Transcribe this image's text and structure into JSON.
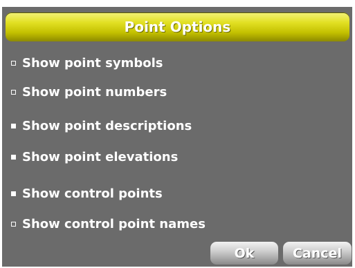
{
  "dialog": {
    "title": "Point Options"
  },
  "options": [
    {
      "label": "Show point symbols",
      "checked": false
    },
    {
      "label": "Show point numbers",
      "checked": false
    },
    {
      "label": "Show point descriptions",
      "checked": true
    },
    {
      "label": "Show point elevations",
      "checked": true
    },
    {
      "label": "Show control points",
      "checked": true
    },
    {
      "label": "Show control point names",
      "checked": false
    }
  ],
  "buttons": {
    "ok_label": "Ok",
    "cancel_label": "Cancel"
  },
  "colors": {
    "panel_background": "#6b6b6b",
    "title_bar": "#d4d200",
    "text": "#ffffff",
    "button": "#c4c4c4"
  }
}
